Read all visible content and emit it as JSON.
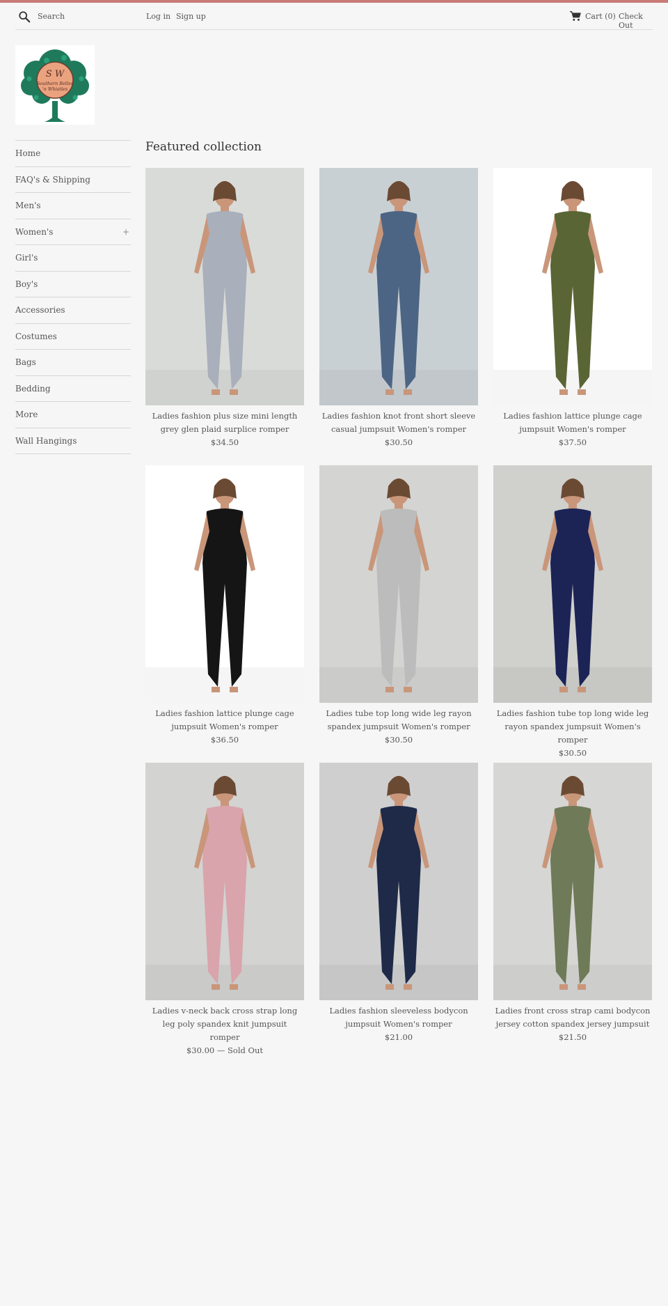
{
  "header": {
    "search_placeholder": "Search",
    "login": "Log in",
    "signup": "Sign up",
    "cart": "Cart (0)",
    "checkout": "Check Out"
  },
  "logo": {
    "text_line1": "S W",
    "text_line2": "Southern Belles",
    "text_line3": "'n Whistles"
  },
  "sidebar": {
    "items": [
      {
        "label": "Home"
      },
      {
        "label": "FAQ's & Shipping"
      },
      {
        "label": "Men's"
      },
      {
        "label": "Women's",
        "expand": "+"
      },
      {
        "label": "Girl's"
      },
      {
        "label": "Boy's"
      },
      {
        "label": "Accessories"
      },
      {
        "label": "Costumes"
      },
      {
        "label": "Bags"
      },
      {
        "label": "Bedding"
      },
      {
        "label": "More"
      },
      {
        "label": "Wall Hangings"
      }
    ]
  },
  "main": {
    "title": "Featured collection",
    "products": [
      {
        "title": "Ladies fashion plus size mini length grey glen plaid surplice romper",
        "price": "$34.50",
        "color": "#a9afbb",
        "bg": "#d9dbd8"
      },
      {
        "title": "Ladies fashion knot front short sleeve casual jumpsuit Women's romper",
        "price": "$30.50",
        "color": "#4d6584",
        "bg": "#c9d0d4"
      },
      {
        "title": "Ladies fashion lattice plunge cage jumpsuit Women's romper",
        "price": "$37.50",
        "color": "#5a6535",
        "bg": "#ffffff"
      },
      {
        "title": "Ladies fashion lattice plunge cage jumpsuit Women's romper",
        "price": "$36.50",
        "color": "#151515",
        "bg": "#ffffff"
      },
      {
        "title": "Ladies tube top long wide leg rayon spandex jumpsuit Women's romper",
        "price": "$30.50",
        "color": "#bcbcbc",
        "bg": "#d4d4d2"
      },
      {
        "title": "Ladies fashion tube top long wide leg rayon spandex jumpsuit Women's romper",
        "price": "$30.50",
        "color": "#1c2456",
        "bg": "#d0d0cd"
      },
      {
        "title": "Ladies v-neck back cross strap long leg poly spandex knit jumpsuit romper",
        "price": "$30.00 — Sold Out",
        "color": "#d9a4ab",
        "bg": "#d3d3d1"
      },
      {
        "title": "Ladies fashion sleeveless bodycon jumpsuit Women's romper",
        "price": "$21.00",
        "color": "#1e2a48",
        "bg": "#cfcfcf"
      },
      {
        "title": "Ladies front cross strap cami bodycon jersey cotton spandex jersey jumpsuit",
        "price": "$21.50",
        "color": "#6f7a58",
        "bg": "#d6d6d4"
      }
    ]
  }
}
